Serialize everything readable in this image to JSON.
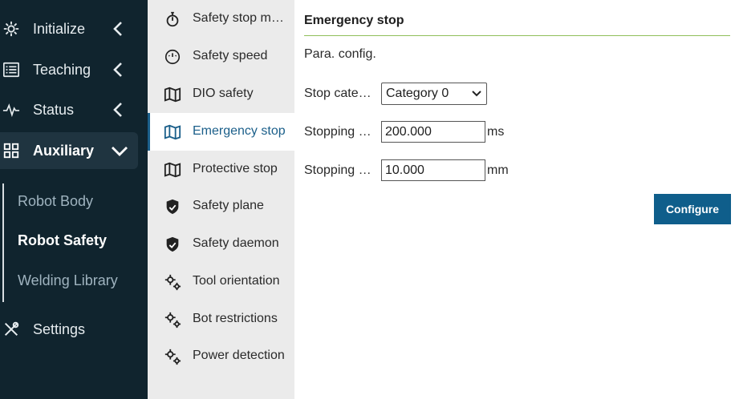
{
  "sidebar": {
    "items": [
      {
        "label": "Initialize",
        "icon": "gear-icon"
      },
      {
        "label": "Teaching",
        "icon": "list-icon"
      },
      {
        "label": "Status",
        "icon": "pulse-icon"
      },
      {
        "label": "Auxiliary",
        "icon": "grid-icon"
      },
      {
        "label": "Settings",
        "icon": "tools-icon"
      }
    ],
    "sub_items": [
      {
        "label": "Robot Body"
      },
      {
        "label": "Robot Safety"
      },
      {
        "label": "Welding Library"
      }
    ]
  },
  "midlist": {
    "items": [
      {
        "label": "Safety stop mode",
        "icon": "stopwatch-icon"
      },
      {
        "label": "Safety speed",
        "icon": "speedometer-icon"
      },
      {
        "label": "DIO safety",
        "icon": "map-icon"
      },
      {
        "label": "Emergency stop",
        "icon": "map-icon"
      },
      {
        "label": "Protective stop",
        "icon": "map-icon"
      },
      {
        "label": "Safety plane",
        "icon": "shield-icon"
      },
      {
        "label": "Safety daemon",
        "icon": "shield-icon"
      },
      {
        "label": "Tool orientation",
        "icon": "gears-icon"
      },
      {
        "label": "Bot restrictions",
        "icon": "gears-icon"
      },
      {
        "label": "Power detection",
        "icon": "gears-icon"
      }
    ]
  },
  "content": {
    "title": "Emergency stop",
    "section": "Para. config.",
    "fields": [
      {
        "label": "Stop category",
        "value": "Category 0"
      },
      {
        "label": "Stopping time",
        "value": "200.000",
        "unit": "ms"
      },
      {
        "label": "Stopping distance",
        "value": "10.000",
        "unit": "mm"
      }
    ],
    "configure_label": "Configure"
  },
  "colors": {
    "sidebar_bg": "#10242e",
    "accent": "#1b5f8a",
    "button": "#0f5e8b",
    "title_rule": "#8fbf5a"
  }
}
